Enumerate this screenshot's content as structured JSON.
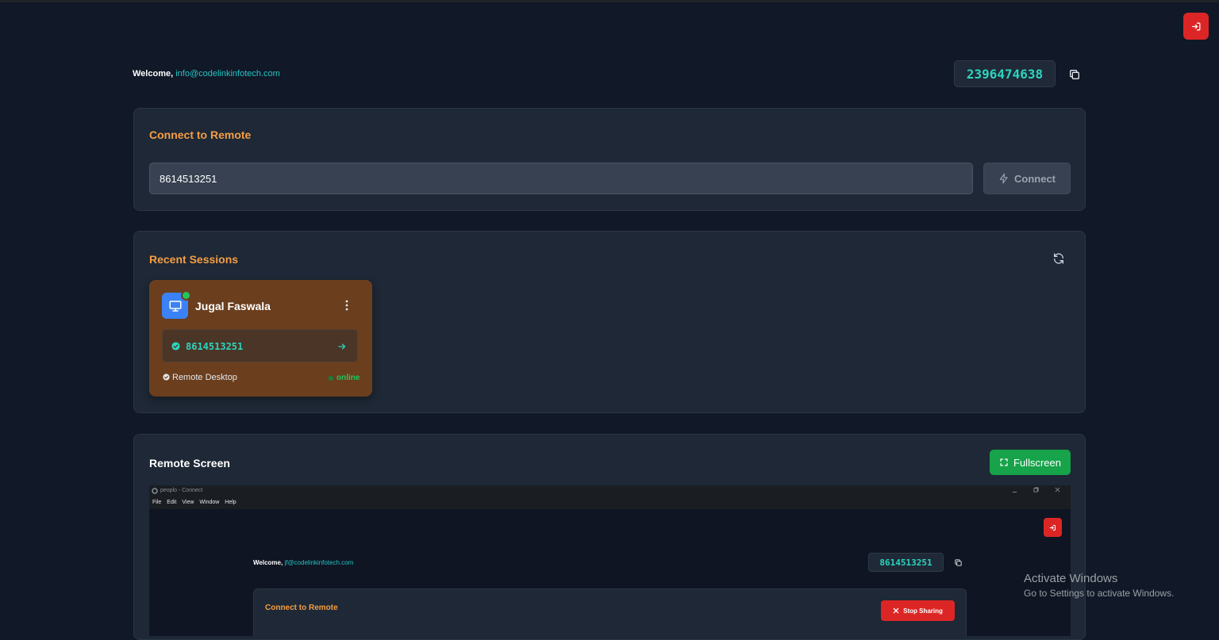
{
  "header": {
    "welcome_label": "Welcome,",
    "email": "info@codelinkinfotech.com",
    "my_id": "2396474638"
  },
  "connect": {
    "title": "Connect to Remote",
    "input_value": "8614513251",
    "button_label": "Connect"
  },
  "recent": {
    "title": "Recent Sessions",
    "sessions": [
      {
        "name": "Jugal Faswala",
        "id": "8614513251",
        "type": "Remote Desktop",
        "status": "online"
      }
    ]
  },
  "remote": {
    "title": "Remote Screen",
    "fullscreen_label": "Fullscreen",
    "screen": {
      "window_title": "peoplo - Connect",
      "menu": [
        "File",
        "Edit",
        "View",
        "Window",
        "Help"
      ],
      "welcome_label": "Welcome,",
      "email": "jf@codelinkinfotech.com",
      "my_id": "8614513251",
      "card_title": "Connect to Remote",
      "stop_label": "Stop Sharing"
    }
  },
  "watermark": {
    "line1": "Activate Windows",
    "line2": "Go to Settings to activate Windows."
  },
  "colors": {
    "background": "#111827",
    "accent_orange": "#f59e42",
    "accent_teal": "#2dd4bf",
    "danger": "#dc2626",
    "success": "#16a34a"
  },
  "icons": [
    "logout-icon",
    "copy-icon",
    "zap-icon",
    "refresh-icon",
    "monitor-icon",
    "more-vertical-icon",
    "check-circle-icon",
    "arrow-right-icon",
    "maximize-icon",
    "x-icon"
  ]
}
